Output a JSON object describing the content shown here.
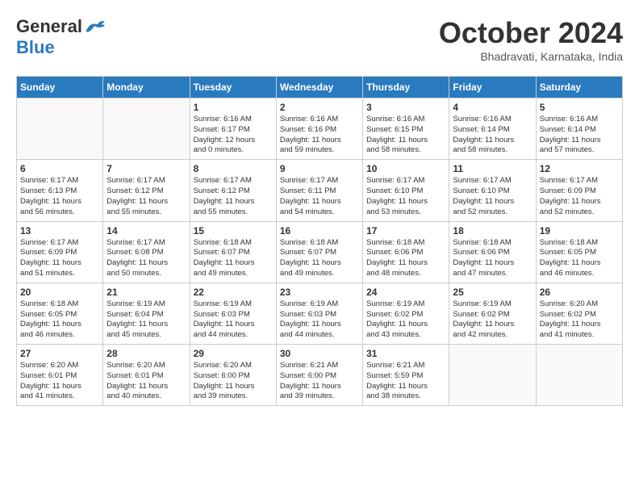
{
  "logo": {
    "general": "General",
    "blue": "Blue"
  },
  "title": "October 2024",
  "location": "Bhadravati, Karnataka, India",
  "days_of_week": [
    "Sunday",
    "Monday",
    "Tuesday",
    "Wednesday",
    "Thursday",
    "Friday",
    "Saturday"
  ],
  "weeks": [
    [
      {
        "day": "",
        "info": ""
      },
      {
        "day": "",
        "info": ""
      },
      {
        "day": "1",
        "info": "Sunrise: 6:16 AM\nSunset: 6:17 PM\nDaylight: 12 hours\nand 0 minutes."
      },
      {
        "day": "2",
        "info": "Sunrise: 6:16 AM\nSunset: 6:16 PM\nDaylight: 11 hours\nand 59 minutes."
      },
      {
        "day": "3",
        "info": "Sunrise: 6:16 AM\nSunset: 6:15 PM\nDaylight: 11 hours\nand 58 minutes."
      },
      {
        "day": "4",
        "info": "Sunrise: 6:16 AM\nSunset: 6:14 PM\nDaylight: 11 hours\nand 58 minutes."
      },
      {
        "day": "5",
        "info": "Sunrise: 6:16 AM\nSunset: 6:14 PM\nDaylight: 11 hours\nand 57 minutes."
      }
    ],
    [
      {
        "day": "6",
        "info": "Sunrise: 6:17 AM\nSunset: 6:13 PM\nDaylight: 11 hours\nand 56 minutes."
      },
      {
        "day": "7",
        "info": "Sunrise: 6:17 AM\nSunset: 6:12 PM\nDaylight: 11 hours\nand 55 minutes."
      },
      {
        "day": "8",
        "info": "Sunrise: 6:17 AM\nSunset: 6:12 PM\nDaylight: 11 hours\nand 55 minutes."
      },
      {
        "day": "9",
        "info": "Sunrise: 6:17 AM\nSunset: 6:11 PM\nDaylight: 11 hours\nand 54 minutes."
      },
      {
        "day": "10",
        "info": "Sunrise: 6:17 AM\nSunset: 6:10 PM\nDaylight: 11 hours\nand 53 minutes."
      },
      {
        "day": "11",
        "info": "Sunrise: 6:17 AM\nSunset: 6:10 PM\nDaylight: 11 hours\nand 52 minutes."
      },
      {
        "day": "12",
        "info": "Sunrise: 6:17 AM\nSunset: 6:09 PM\nDaylight: 11 hours\nand 52 minutes."
      }
    ],
    [
      {
        "day": "13",
        "info": "Sunrise: 6:17 AM\nSunset: 6:09 PM\nDaylight: 11 hours\nand 51 minutes."
      },
      {
        "day": "14",
        "info": "Sunrise: 6:17 AM\nSunset: 6:08 PM\nDaylight: 11 hours\nand 50 minutes."
      },
      {
        "day": "15",
        "info": "Sunrise: 6:18 AM\nSunset: 6:07 PM\nDaylight: 11 hours\nand 49 minutes."
      },
      {
        "day": "16",
        "info": "Sunrise: 6:18 AM\nSunset: 6:07 PM\nDaylight: 11 hours\nand 49 minutes."
      },
      {
        "day": "17",
        "info": "Sunrise: 6:18 AM\nSunset: 6:06 PM\nDaylight: 11 hours\nand 48 minutes."
      },
      {
        "day": "18",
        "info": "Sunrise: 6:18 AM\nSunset: 6:06 PM\nDaylight: 11 hours\nand 47 minutes."
      },
      {
        "day": "19",
        "info": "Sunrise: 6:18 AM\nSunset: 6:05 PM\nDaylight: 11 hours\nand 46 minutes."
      }
    ],
    [
      {
        "day": "20",
        "info": "Sunrise: 6:18 AM\nSunset: 6:05 PM\nDaylight: 11 hours\nand 46 minutes."
      },
      {
        "day": "21",
        "info": "Sunrise: 6:19 AM\nSunset: 6:04 PM\nDaylight: 11 hours\nand 45 minutes."
      },
      {
        "day": "22",
        "info": "Sunrise: 6:19 AM\nSunset: 6:03 PM\nDaylight: 11 hours\nand 44 minutes."
      },
      {
        "day": "23",
        "info": "Sunrise: 6:19 AM\nSunset: 6:03 PM\nDaylight: 11 hours\nand 44 minutes."
      },
      {
        "day": "24",
        "info": "Sunrise: 6:19 AM\nSunset: 6:02 PM\nDaylight: 11 hours\nand 43 minutes."
      },
      {
        "day": "25",
        "info": "Sunrise: 6:19 AM\nSunset: 6:02 PM\nDaylight: 11 hours\nand 42 minutes."
      },
      {
        "day": "26",
        "info": "Sunrise: 6:20 AM\nSunset: 6:02 PM\nDaylight: 11 hours\nand 41 minutes."
      }
    ],
    [
      {
        "day": "27",
        "info": "Sunrise: 6:20 AM\nSunset: 6:01 PM\nDaylight: 11 hours\nand 41 minutes."
      },
      {
        "day": "28",
        "info": "Sunrise: 6:20 AM\nSunset: 6:01 PM\nDaylight: 11 hours\nand 40 minutes."
      },
      {
        "day": "29",
        "info": "Sunrise: 6:20 AM\nSunset: 6:00 PM\nDaylight: 11 hours\nand 39 minutes."
      },
      {
        "day": "30",
        "info": "Sunrise: 6:21 AM\nSunset: 6:00 PM\nDaylight: 11 hours\nand 39 minutes."
      },
      {
        "day": "31",
        "info": "Sunrise: 6:21 AM\nSunset: 5:59 PM\nDaylight: 11 hours\nand 38 minutes."
      },
      {
        "day": "",
        "info": ""
      },
      {
        "day": "",
        "info": ""
      }
    ]
  ]
}
